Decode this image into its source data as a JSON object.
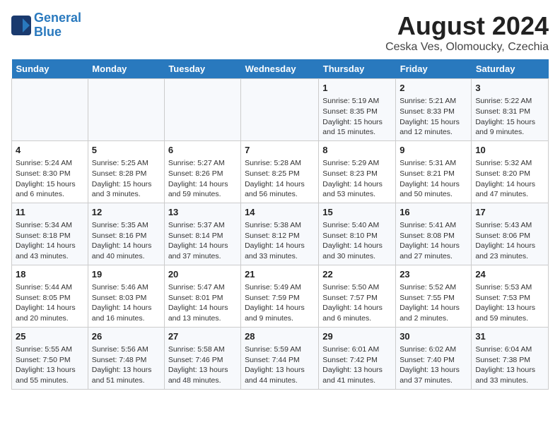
{
  "header": {
    "logo_line1": "General",
    "logo_line2": "Blue",
    "title": "August 2024",
    "location": "Ceska Ves, Olomoucky, Czechia"
  },
  "weekdays": [
    "Sunday",
    "Monday",
    "Tuesday",
    "Wednesday",
    "Thursday",
    "Friday",
    "Saturday"
  ],
  "weeks": [
    [
      {
        "day": "",
        "content": ""
      },
      {
        "day": "",
        "content": ""
      },
      {
        "day": "",
        "content": ""
      },
      {
        "day": "",
        "content": ""
      },
      {
        "day": "1",
        "content": "Sunrise: 5:19 AM\nSunset: 8:35 PM\nDaylight: 15 hours\nand 15 minutes."
      },
      {
        "day": "2",
        "content": "Sunrise: 5:21 AM\nSunset: 8:33 PM\nDaylight: 15 hours\nand 12 minutes."
      },
      {
        "day": "3",
        "content": "Sunrise: 5:22 AM\nSunset: 8:31 PM\nDaylight: 15 hours\nand 9 minutes."
      }
    ],
    [
      {
        "day": "4",
        "content": "Sunrise: 5:24 AM\nSunset: 8:30 PM\nDaylight: 15 hours\nand 6 minutes."
      },
      {
        "day": "5",
        "content": "Sunrise: 5:25 AM\nSunset: 8:28 PM\nDaylight: 15 hours\nand 3 minutes."
      },
      {
        "day": "6",
        "content": "Sunrise: 5:27 AM\nSunset: 8:26 PM\nDaylight: 14 hours\nand 59 minutes."
      },
      {
        "day": "7",
        "content": "Sunrise: 5:28 AM\nSunset: 8:25 PM\nDaylight: 14 hours\nand 56 minutes."
      },
      {
        "day": "8",
        "content": "Sunrise: 5:29 AM\nSunset: 8:23 PM\nDaylight: 14 hours\nand 53 minutes."
      },
      {
        "day": "9",
        "content": "Sunrise: 5:31 AM\nSunset: 8:21 PM\nDaylight: 14 hours\nand 50 minutes."
      },
      {
        "day": "10",
        "content": "Sunrise: 5:32 AM\nSunset: 8:20 PM\nDaylight: 14 hours\nand 47 minutes."
      }
    ],
    [
      {
        "day": "11",
        "content": "Sunrise: 5:34 AM\nSunset: 8:18 PM\nDaylight: 14 hours\nand 43 minutes."
      },
      {
        "day": "12",
        "content": "Sunrise: 5:35 AM\nSunset: 8:16 PM\nDaylight: 14 hours\nand 40 minutes."
      },
      {
        "day": "13",
        "content": "Sunrise: 5:37 AM\nSunset: 8:14 PM\nDaylight: 14 hours\nand 37 minutes."
      },
      {
        "day": "14",
        "content": "Sunrise: 5:38 AM\nSunset: 8:12 PM\nDaylight: 14 hours\nand 33 minutes."
      },
      {
        "day": "15",
        "content": "Sunrise: 5:40 AM\nSunset: 8:10 PM\nDaylight: 14 hours\nand 30 minutes."
      },
      {
        "day": "16",
        "content": "Sunrise: 5:41 AM\nSunset: 8:08 PM\nDaylight: 14 hours\nand 27 minutes."
      },
      {
        "day": "17",
        "content": "Sunrise: 5:43 AM\nSunset: 8:06 PM\nDaylight: 14 hours\nand 23 minutes."
      }
    ],
    [
      {
        "day": "18",
        "content": "Sunrise: 5:44 AM\nSunset: 8:05 PM\nDaylight: 14 hours\nand 20 minutes."
      },
      {
        "day": "19",
        "content": "Sunrise: 5:46 AM\nSunset: 8:03 PM\nDaylight: 14 hours\nand 16 minutes."
      },
      {
        "day": "20",
        "content": "Sunrise: 5:47 AM\nSunset: 8:01 PM\nDaylight: 14 hours\nand 13 minutes."
      },
      {
        "day": "21",
        "content": "Sunrise: 5:49 AM\nSunset: 7:59 PM\nDaylight: 14 hours\nand 9 minutes."
      },
      {
        "day": "22",
        "content": "Sunrise: 5:50 AM\nSunset: 7:57 PM\nDaylight: 14 hours\nand 6 minutes."
      },
      {
        "day": "23",
        "content": "Sunrise: 5:52 AM\nSunset: 7:55 PM\nDaylight: 14 hours\nand 2 minutes."
      },
      {
        "day": "24",
        "content": "Sunrise: 5:53 AM\nSunset: 7:53 PM\nDaylight: 13 hours\nand 59 minutes."
      }
    ],
    [
      {
        "day": "25",
        "content": "Sunrise: 5:55 AM\nSunset: 7:50 PM\nDaylight: 13 hours\nand 55 minutes."
      },
      {
        "day": "26",
        "content": "Sunrise: 5:56 AM\nSunset: 7:48 PM\nDaylight: 13 hours\nand 51 minutes."
      },
      {
        "day": "27",
        "content": "Sunrise: 5:58 AM\nSunset: 7:46 PM\nDaylight: 13 hours\nand 48 minutes."
      },
      {
        "day": "28",
        "content": "Sunrise: 5:59 AM\nSunset: 7:44 PM\nDaylight: 13 hours\nand 44 minutes."
      },
      {
        "day": "29",
        "content": "Sunrise: 6:01 AM\nSunset: 7:42 PM\nDaylight: 13 hours\nand 41 minutes."
      },
      {
        "day": "30",
        "content": "Sunrise: 6:02 AM\nSunset: 7:40 PM\nDaylight: 13 hours\nand 37 minutes."
      },
      {
        "day": "31",
        "content": "Sunrise: 6:04 AM\nSunset: 7:38 PM\nDaylight: 13 hours\nand 33 minutes."
      }
    ]
  ]
}
